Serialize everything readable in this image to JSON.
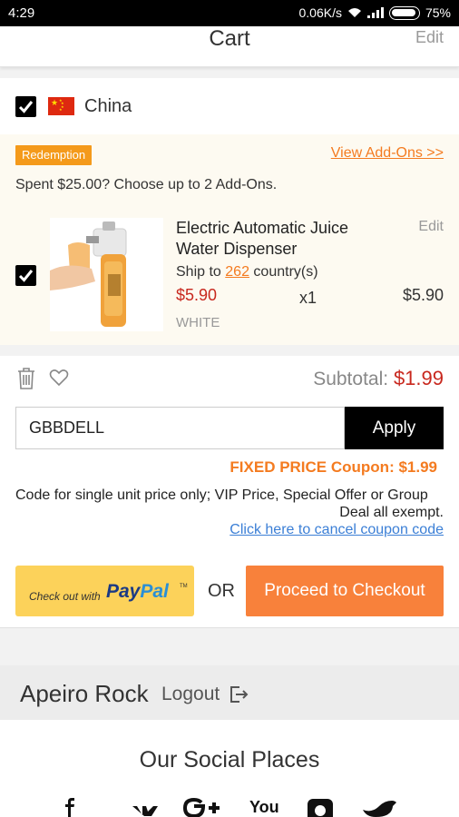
{
  "status_bar": {
    "time": "4:29",
    "network_speed": "0.06K/s",
    "battery": "75%"
  },
  "header": {
    "title": "Cart",
    "edit_label": "Edit"
  },
  "store": {
    "country": "China",
    "checked": true
  },
  "promotion": {
    "badge": "Redemption",
    "view_addons": "View Add-Ons >>",
    "message": "Spent $25.00? Choose up to 2 Add-Ons."
  },
  "item": {
    "name": "Electric Automatic Juice Water Dispenser",
    "edit_label": "Edit",
    "ship_prefix": "Ship to",
    "ship_count": "262",
    "ship_suffix": "country(s)",
    "price": "$5.90",
    "quantity": "x1",
    "line_total": "$5.90",
    "variant": "WHITE",
    "checked": true
  },
  "summary": {
    "subtotal_label": "Subtotal:",
    "subtotal_value": "$1.99",
    "coupon_value": "GBBDELL",
    "apply_label": "Apply",
    "coupon_result": "FIXED PRICE Coupon: $1.99",
    "note_line1": "Code for single unit price only; VIP Price, Special Offer or Group",
    "note_line2": "Deal all exempt.",
    "cancel_link": "Click here to cancel coupon code"
  },
  "checkout": {
    "paypal_prefix": "Check out with",
    "paypal_pay": "Pay",
    "paypal_pal": "Pal",
    "paypal_tm": "TM",
    "or_label": "OR",
    "proceed_label": "Proceed to Checkout"
  },
  "account": {
    "name": "Apeiro Rock",
    "logout_label": "Logout"
  },
  "footer": {
    "social_title": "Our Social Places",
    "social_icons": [
      "facebook-icon",
      "vk-icon",
      "google-plus-icon",
      "youtube-icon",
      "instagram-icon",
      "twitter-icon"
    ],
    "youtube_text": "You"
  },
  "colors": {
    "accent_orange": "#f47b20",
    "price_red": "#c8281e",
    "checkout_button": "#f8813b",
    "paypal_yellow": "#fcd25a",
    "link_blue": "#3b7fd6"
  }
}
